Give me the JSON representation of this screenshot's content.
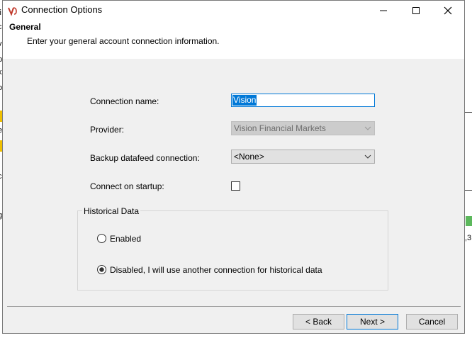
{
  "window": {
    "title": "Connection Options",
    "controls": [
      "minimize-icon",
      "maximize-icon",
      "close-icon"
    ]
  },
  "header": {
    "title": "General",
    "description": "Enter your general account connection information."
  },
  "form": {
    "connection_name_label": "Connection name:",
    "connection_name_value": "Vision",
    "provider_label": "Provider:",
    "provider_value": "Vision Financial Markets",
    "backup_label": "Backup datafeed connection:",
    "backup_value": "<None>",
    "startup_label": "Connect on startup:",
    "startup_checked": false
  },
  "historical": {
    "title": "Historical Data",
    "options": [
      {
        "label": "Enabled",
        "selected": false
      },
      {
        "label": "Disabled, I will use another connection for historical data",
        "selected": true
      }
    ]
  },
  "buttons": {
    "back": "< Back",
    "next": "Next >",
    "cancel": "Cancel"
  },
  "colors": {
    "accent": "#0078d7",
    "dialog_bg": "#f0f0f0",
    "icon_red": "#c0392b"
  }
}
